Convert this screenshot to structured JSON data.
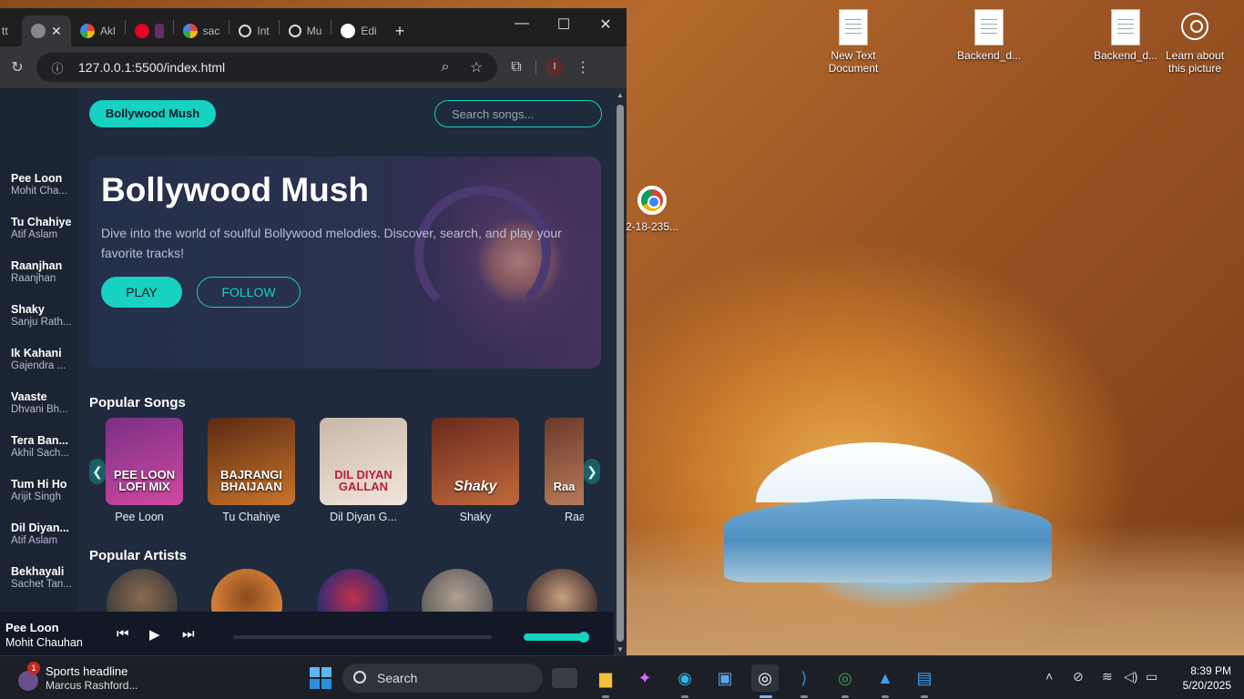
{
  "desktop": {
    "icons": [
      {
        "label": "New Text Document"
      },
      {
        "label": "Backend_d..."
      },
      {
        "label": "Backend_d..."
      },
      {
        "label": "Learn about this picture"
      },
      {
        "label": "2-18-235..."
      }
    ]
  },
  "browser": {
    "tabs": [
      {
        "label": "tt",
        "icon": "generic-icon"
      },
      {
        "label": "",
        "icon": "globe-icon"
      },
      {
        "label": "Akl",
        "icon": "google-icon"
      },
      {
        "label": "",
        "icon": "pinterest-icon"
      },
      {
        "label": "sac",
        "icon": "google-icon"
      },
      {
        "label": "Int",
        "icon": "openai-icon"
      },
      {
        "label": "Mu",
        "icon": "openai-icon"
      },
      {
        "label": "Edi",
        "icon": "github-icon"
      }
    ],
    "new_tab": "+",
    "url": "127.0.0.1:5500/index.html",
    "profile_initial": "I"
  },
  "app": {
    "brand": "Bollywood Mush",
    "search_placeholder": "Search songs...",
    "hero": {
      "title": "Bollywood Mush",
      "description": "Dive into the world of soulful Bollywood melodies. Discover, search, and play your favorite tracks!",
      "play_label": "PLAY",
      "follow_label": "FOLLOW"
    },
    "sidebar": [
      {
        "title": "Pee Loon",
        "artist": "Mohit Cha..."
      },
      {
        "title": "Tu Chahiye",
        "artist": "Atif Aslam"
      },
      {
        "title": "Raanjhan",
        "artist": "Raanjhan"
      },
      {
        "title": "Shaky",
        "artist": "Sanju Rath..."
      },
      {
        "title": "Ik Kahani",
        "artist": "Gajendra ..."
      },
      {
        "title": "Vaaste",
        "artist": "Dhvani Bh..."
      },
      {
        "title": "Tera Ban...",
        "artist": "Akhil Sach..."
      },
      {
        "title": "Tum Hi Ho",
        "artist": "Arijit Singh"
      },
      {
        "title": "Dil Diyan...",
        "artist": "Atif Aslam"
      },
      {
        "title": "Bekhayali",
        "artist": "Sachet Tan..."
      }
    ],
    "popular_songs_title": "Popular Songs",
    "popular_songs": [
      {
        "name": "Pee Loon",
        "cover_text": "PEE LOON LOFI MIX",
        "color1": "#7a2f86",
        "color2": "#d04aa0"
      },
      {
        "name": "Tu Chahiye",
        "cover_text": "BAJRANGI BHAIJAAN",
        "color1": "#5a2a14",
        "color2": "#c9752a"
      },
      {
        "name": "Dil Diyan G...",
        "cover_text": "DIL DIYAN GALLAN",
        "color1": "#c9b7a8",
        "color2": "#f1e6dc"
      },
      {
        "name": "Shaky",
        "cover_text": "Shaky",
        "color1": "#6a2a1e",
        "color2": "#c06a3c"
      },
      {
        "name": "Raa",
        "cover_text": "Raa",
        "color1": "#6b3a2a",
        "color2": "#b87a5a"
      }
    ],
    "popular_artists_title": "Popular Artists",
    "popular_artists": [
      {
        "color1": "#3a3a3a",
        "color2": "#8a6a50"
      },
      {
        "color1": "#e08a3a",
        "color2": "#8a4a20"
      },
      {
        "color1": "#1a2a7a",
        "color2": "#c0304a"
      },
      {
        "color1": "#5a5a5a",
        "color2": "#b0a090"
      },
      {
        "color1": "#3a2a2a",
        "color2": "#c8a080"
      }
    ],
    "carousel_prev": "❮",
    "carousel_next": "❯",
    "player": {
      "title": "Pee Loon",
      "artist": "Mohit Chauhan",
      "progress": 0,
      "volume": 1.0
    },
    "accent": "#17d1c1"
  },
  "taskbar": {
    "news_title": "Sports headline",
    "news_subtitle": "Marcus Rashford...",
    "news_badge": "1",
    "search_label": "Search",
    "time": "8:39 PM",
    "date": "5/20/2025"
  }
}
